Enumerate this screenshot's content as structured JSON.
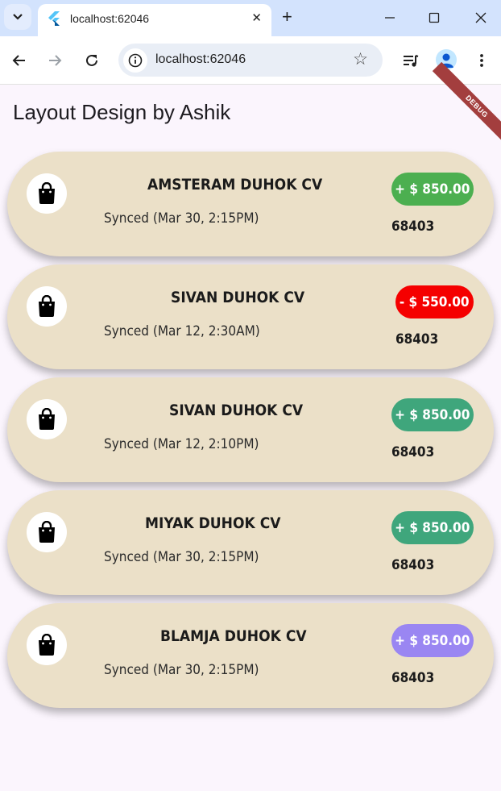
{
  "browser": {
    "tab_title": "localhost:62046",
    "url": "localhost:62046",
    "tab_close_glyph": "✕",
    "new_tab_glyph": "+",
    "star_glyph": "☆",
    "icons": [
      "tab-list-icon",
      "flutter-favicon-icon",
      "close-icon",
      "new-tab-icon",
      "minimize-icon",
      "maximize-icon",
      "close-window-icon",
      "back-icon",
      "forward-icon",
      "reload-icon",
      "site-info-icon",
      "bookmark-star-icon",
      "media-controls-icon",
      "profile-avatar-icon",
      "more-menu-icon"
    ]
  },
  "page": {
    "title": "Layout Design by Ashik",
    "debug_banner": "DEBUG"
  },
  "colors": {
    "card_background": "#ebe0c8",
    "green": "#4caf50",
    "red": "#f50000",
    "teal": "#3fa67c",
    "purple": "#9a86f2",
    "debug": "#a33e3e"
  },
  "cards": [
    {
      "name": "AMSTERAM DUHOK CV",
      "synced": "Synced (Mar 30, 2:15PM)",
      "amount": "+ $ 850.00",
      "code": "68403",
      "badge_color": "#4caf50",
      "icon": "shopping-bag-icon"
    },
    {
      "name": "SIVAN DUHOK CV",
      "synced": "Synced (Mar 12, 2:30AM)",
      "amount": "- $ 550.00",
      "code": "68403",
      "badge_color": "#f50000",
      "icon": "shopping-bag-icon"
    },
    {
      "name": "SIVAN DUHOK CV",
      "synced": "Synced (Mar 12, 2:10PM)",
      "amount": "+ $ 850.00",
      "code": "68403",
      "badge_color": "#3fa67c",
      "icon": "shopping-bag-icon"
    },
    {
      "name": "MIYAK DUHOK CV",
      "synced": "Synced (Mar 30, 2:15PM)",
      "amount": "+ $ 850.00",
      "code": "68403",
      "badge_color": "#3fa67c",
      "icon": "shopping-bag-icon"
    },
    {
      "name": "BLAMJA DUHOK CV",
      "synced": "Synced (Mar 30, 2:15PM)",
      "amount": "+ $ 850.00",
      "code": "68403",
      "badge_color": "#9a86f2",
      "icon": "shopping-bag-icon"
    }
  ]
}
